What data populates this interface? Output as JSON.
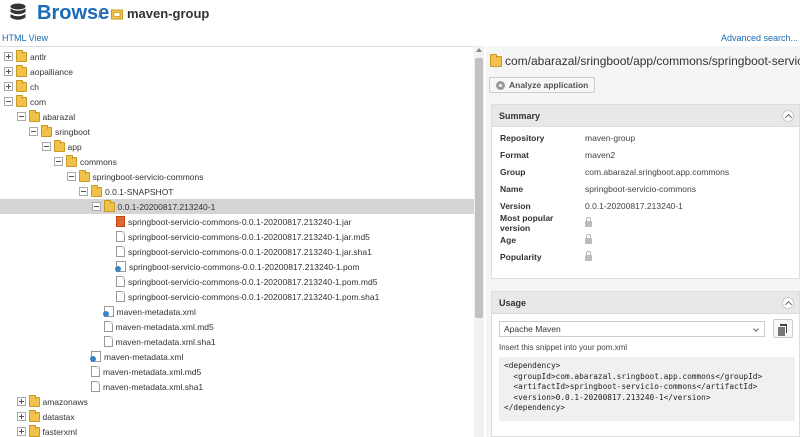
{
  "header": {
    "title": "Browse",
    "separator": "/",
    "repository": "maven-group"
  },
  "links": {
    "html_view": "HTML View",
    "advanced_search": "Advanced search..."
  },
  "tree": [
    {
      "label": "antlr",
      "type": "folder",
      "depth": 0,
      "toggle": "plus"
    },
    {
      "label": "aopalliance",
      "type": "folder",
      "depth": 0,
      "toggle": "plus"
    },
    {
      "label": "ch",
      "type": "folder",
      "depth": 0,
      "toggle": "plus"
    },
    {
      "label": "com",
      "type": "folder",
      "depth": 0,
      "toggle": "minus"
    },
    {
      "label": "abarazal",
      "type": "folder",
      "depth": 1,
      "toggle": "minus"
    },
    {
      "label": "sringboot",
      "type": "folder",
      "depth": 2,
      "toggle": "minus"
    },
    {
      "label": "app",
      "type": "folder",
      "depth": 3,
      "toggle": "minus"
    },
    {
      "label": "commons",
      "type": "folder",
      "depth": 4,
      "toggle": "minus"
    },
    {
      "label": "springboot-servicio-commons",
      "type": "folder",
      "depth": 5,
      "toggle": "minus"
    },
    {
      "label": "0.0.1-SNAPSHOT",
      "type": "folder",
      "depth": 6,
      "toggle": "minus"
    },
    {
      "label": "0.0.1-20200817.213240-1",
      "type": "folder",
      "depth": 7,
      "toggle": "minus",
      "selected": true
    },
    {
      "label": "springboot-servicio-commons-0.0.1-20200817.213240-1.jar",
      "type": "jar",
      "depth": 8
    },
    {
      "label": "springboot-servicio-commons-0.0.1-20200817.213240-1.jar.md5",
      "type": "file",
      "depth": 8
    },
    {
      "label": "springboot-servicio-commons-0.0.1-20200817.213240-1.jar.sha1",
      "type": "file",
      "depth": 8
    },
    {
      "label": "springboot-servicio-commons-0.0.1-20200817.213240-1.pom",
      "type": "pom",
      "depth": 8
    },
    {
      "label": "springboot-servicio-commons-0.0.1-20200817.213240-1.pom.md5",
      "type": "file",
      "depth": 8
    },
    {
      "label": "springboot-servicio-commons-0.0.1-20200817.213240-1.pom.sha1",
      "type": "file",
      "depth": 8
    },
    {
      "label": "maven-metadata.xml",
      "type": "pom",
      "depth": 7
    },
    {
      "label": "maven-metadata.xml.md5",
      "type": "file",
      "depth": 7
    },
    {
      "label": "maven-metadata.xml.sha1",
      "type": "file",
      "depth": 7
    },
    {
      "label": "maven-metadata.xml",
      "type": "pom",
      "depth": 6
    },
    {
      "label": "maven-metadata.xml.md5",
      "type": "file",
      "depth": 6
    },
    {
      "label": "maven-metadata.xml.sha1",
      "type": "file",
      "depth": 6
    },
    {
      "label": "amazonaws",
      "type": "folder",
      "depth": 1,
      "toggle": "plus"
    },
    {
      "label": "datastax",
      "type": "folder",
      "depth": 1,
      "toggle": "plus"
    },
    {
      "label": "fasterxml",
      "type": "folder",
      "depth": 1,
      "toggle": "plus"
    }
  ],
  "details": {
    "path": "com/abarazal/sringboot/app/commons/springboot-servicio...",
    "analyze_label": "Analyze application",
    "summary": {
      "title": "Summary",
      "rows": [
        {
          "key": "Repository",
          "value": "maven-group"
        },
        {
          "key": "Format",
          "value": "maven2"
        },
        {
          "key": "Group",
          "value": "com.abarazal.sringboot.app.commons"
        },
        {
          "key": "Name",
          "value": "springboot-servicio-commons"
        },
        {
          "key": "Version",
          "value": "0.0.1-20200817.213240-1"
        },
        {
          "key": "Most popular version",
          "value": "",
          "locked": true
        },
        {
          "key": "Age",
          "value": "",
          "locked": true
        },
        {
          "key": "Popularity",
          "value": "",
          "locked": true
        }
      ]
    },
    "usage": {
      "title": "Usage",
      "selected": "Apache Maven",
      "hint": "Insert this snippet into your pom.xml",
      "snippet": "<dependency>\n  <groupId>com.abarazal.sringboot.app.commons</groupId>\n  <artifactId>springboot-servicio-commons</artifactId>\n  <version>0.0.1-20200817.213240-1</version>\n</dependency>"
    }
  },
  "colors": {
    "accent": "#1a6bb8",
    "folder": "#f0c14b",
    "selected_row": "#d4d4d4"
  }
}
